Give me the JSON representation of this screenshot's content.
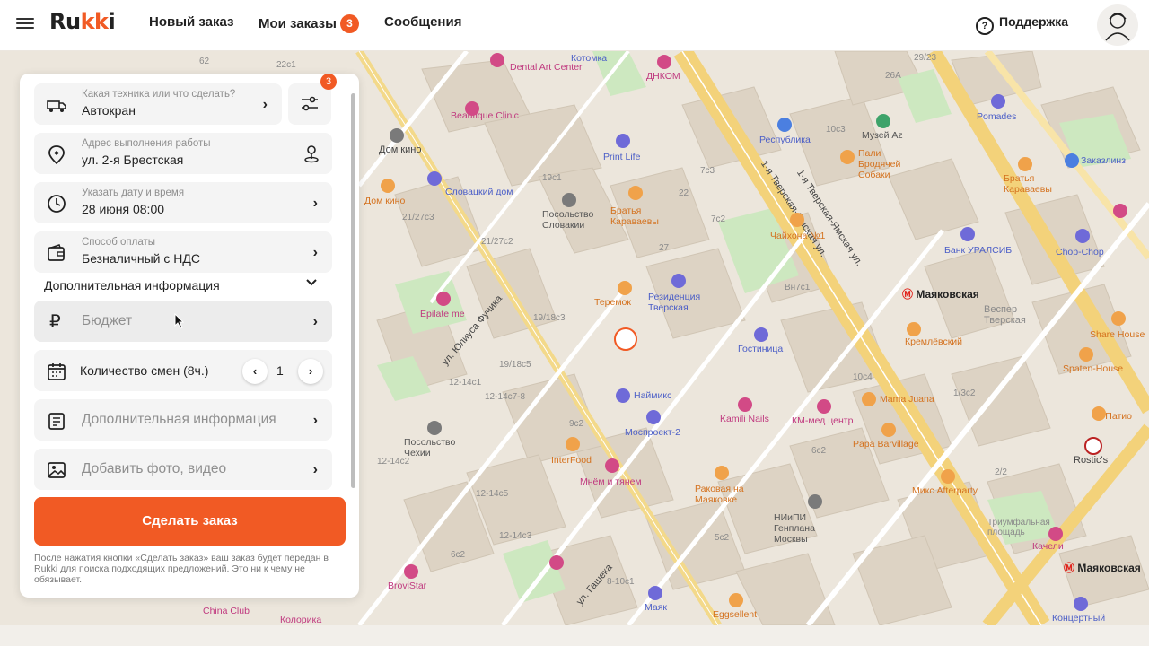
{
  "header": {
    "logo": "Rukki",
    "nav": [
      {
        "label": "Новый заказ"
      },
      {
        "label": "Мои заказы",
        "badge": "3"
      },
      {
        "label": "Сообщения"
      }
    ],
    "support_label": "Поддержка"
  },
  "form": {
    "equipment": {
      "label": "Какая техника или что сделать?",
      "value": "Автокран",
      "filter_badge": "3"
    },
    "address": {
      "label": "Адрес выполнения работы",
      "value": "ул. 2-я Брестская"
    },
    "datetime": {
      "label": "Указать дату и время",
      "value": "28 июня 08:00"
    },
    "payment": {
      "label": "Способ оплаты",
      "value": "Безналичный с НДС"
    },
    "extra_section_title": "Дополнительная информация",
    "budget_label": "Бюджет",
    "shifts": {
      "label": "Количество смен (8ч.)",
      "value": "1",
      "minus": "‹",
      "plus": "›"
    },
    "extra_info_label": "Дополнительная информация",
    "add_media_label": "Добавить фото, видео",
    "submit_label": "Сделать заказ",
    "note": "После нажатия кнопки «Сделать заказ» ваш заказ будет передан в Rukki для поиска подходящих предложений. Это ни к чему не обязывает."
  },
  "map": {
    "streets": [
      "1-я Тверская-Ямская ул.",
      "ул. Юлиуса Фучика",
      "ул. Гашека"
    ],
    "metro": [
      "Маяковская",
      "Маяковская"
    ],
    "places": {
      "dental": "Dental Art Center",
      "dnkom": "ДНКОМ",
      "kotomka": "Котомка",
      "beautique": "Beautique Clinic",
      "printlife": "Print Life",
      "respublika": "Республика",
      "domkino1": "Дом кино",
      "domkino2": "Дом кино",
      "slovacki": "Словацкий дом",
      "posolstvo_slov": "Посольство Словакии",
      "bratya1": "Братья Караваевы",
      "teremok": "Теремок",
      "rezidencia": "Резиденция Тверская",
      "epilate": "Epilate me",
      "gostinica": "Гостиница",
      "chaihona": "Чайхона №1",
      "naimiks": "Наймикс",
      "mosproekt": "Моспроект-2",
      "kamili": "Kamili Nails",
      "kmmed": "КМ-мед центр",
      "posolstvo_cz": "Посольство Чехии",
      "interfood": "InterFood",
      "mnem": "Мнём и тянем",
      "rakovaya": "Раковая на Маяковке",
      "niipi": "НИиПИ Генплана Москвы",
      "mama": "Mama Juana",
      "papa": "Papa Barvillage",
      "miks": "Микс Afterparty",
      "kremlevsky": "Кремлёвский",
      "vesper": "Веспер Тверская",
      "muzei": "Музей Az",
      "brodyachie": "Пали Бродячей Собаки",
      "pomades": "Pomades",
      "bratya2": "Братья Караваевы",
      "zakazlinz": "Заказлинз",
      "bank": "Банк УРАЛСИБ",
      "chopchop": "Chop-Chop",
      "sharehouse": "Share House",
      "spaten": "Spaten-House",
      "ilpatio": "IL Патио",
      "rostics": "Rostic's",
      "triumph": "Триумфальная площадь",
      "kacheli": "Качели",
      "koncertny": "Концертный",
      "brovistar": "BroviStar",
      "chinaclub": "China Club",
      "kolorika": "Колорика",
      "eggsellent": "Eggsellent",
      "mayak": "Маяк"
    },
    "numbers": [
      "62",
      "22с1",
      "19с1",
      "7с3",
      "22",
      "27",
      "7с2",
      "21/27с3",
      "21/27с2",
      "19/18с3",
      "19/18с5",
      "12-14с1",
      "12-14с7-8",
      "9с2",
      "12-14с5",
      "12-14с2",
      "12-14с3",
      "6с2",
      "5с2",
      "8-10с1",
      "10с4",
      "6с2",
      "26А",
      "29/23",
      "10с3",
      "Вн7с1",
      "1/3с2",
      "2/2"
    ]
  }
}
